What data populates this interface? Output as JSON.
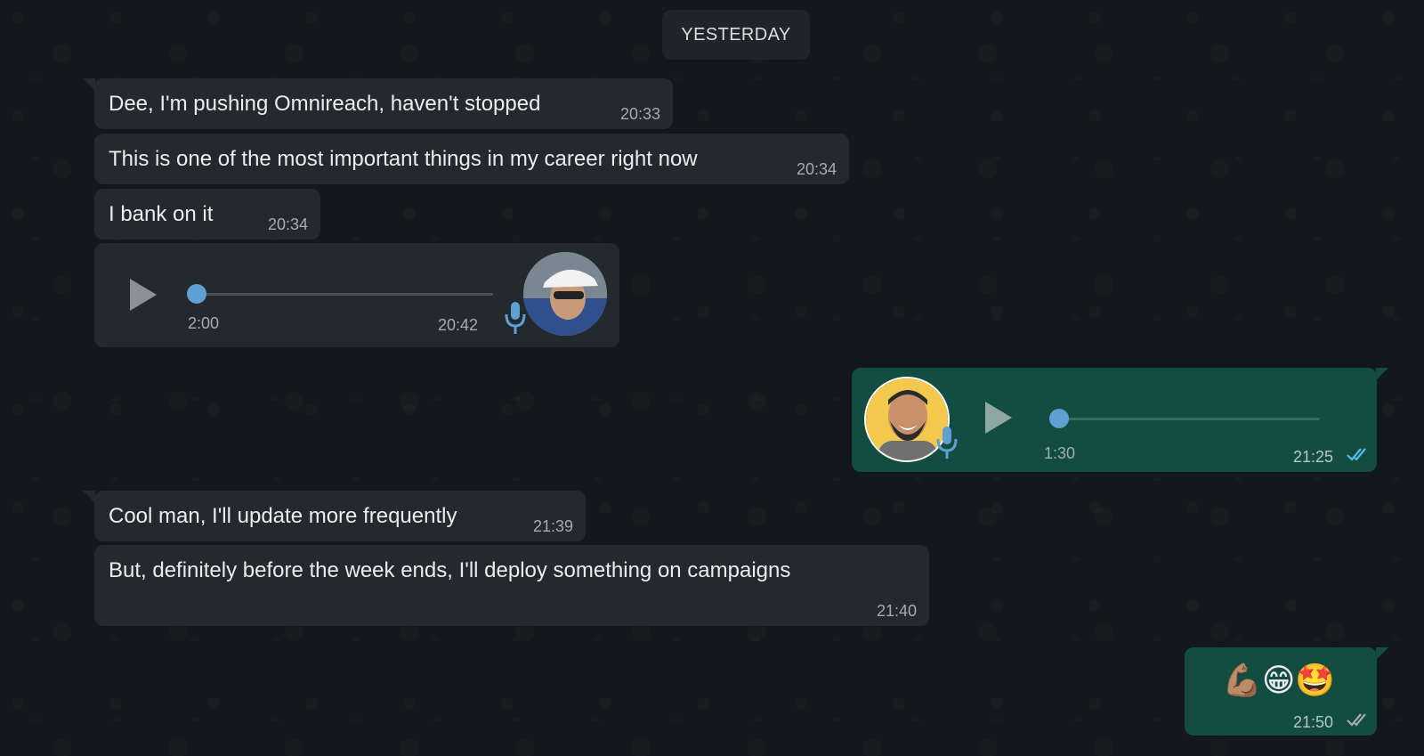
{
  "date_divider": "YESTERDAY",
  "messages": [
    {
      "text": "Dee, I'm pushing Omnireach, haven't stopped",
      "time": "20:33"
    },
    {
      "text": "This is one of the most important things in my career right now",
      "time": "20:34"
    },
    {
      "text": "I bank on it",
      "time": "20:34"
    },
    {
      "type": "voice",
      "duration": "2:00",
      "time": "20:42",
      "progress": 0
    },
    {
      "type": "voice",
      "duration": "1:30",
      "time": "21:25",
      "progress": 0,
      "status": "read"
    },
    {
      "text": "Cool man, I'll update more frequently",
      "time": "21:39"
    },
    {
      "text": "But, definitely before the week ends, I'll deploy something on campaigns",
      "time": "21:40"
    },
    {
      "text": "💪🏽😁🤩",
      "time": "21:50",
      "status": "delivered"
    }
  ],
  "colors": {
    "background": "#12181b",
    "incoming_bubble": "#24292d",
    "outgoing_bubble": "#134d42",
    "read_ticks": "#53bdeb",
    "delivered_ticks": "#a3acb0",
    "audio_knob": "#5fa0d4"
  },
  "icons": [
    "play-icon",
    "mic-icon",
    "double-check-icon"
  ]
}
